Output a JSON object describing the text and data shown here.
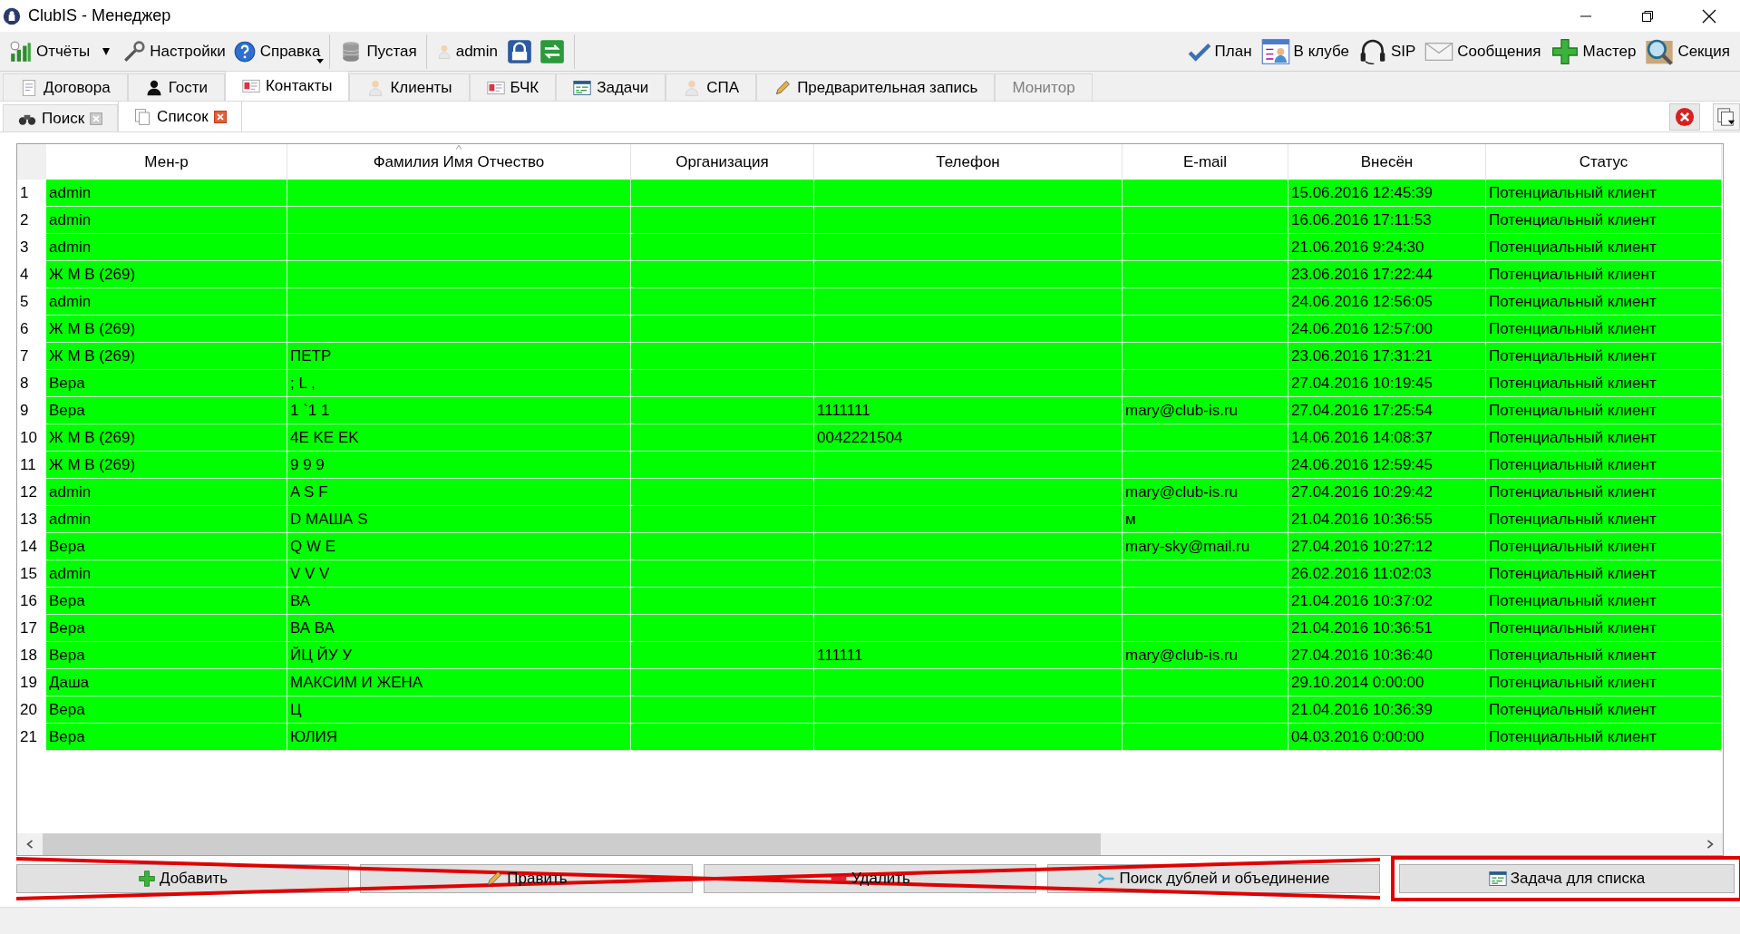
{
  "window": {
    "title": "ClubIS - Менеджер"
  },
  "toolbar": {
    "left": [
      {
        "label": "Отчёты",
        "dropdown": true
      },
      {
        "label": "Настройки",
        "dropdown": false
      },
      {
        "label": "Справка",
        "dropdown": true
      },
      {
        "label": "Пустая",
        "dropdown": false
      },
      {
        "label": "admin",
        "dropdown": false
      }
    ],
    "right": [
      {
        "label": "План"
      },
      {
        "label": "В клубе"
      },
      {
        "label": "SIP"
      },
      {
        "label": "Сообщения"
      },
      {
        "label": "Мастер"
      },
      {
        "label": "Секция"
      }
    ]
  },
  "tabs": [
    {
      "label": "Договора",
      "selected": false,
      "disabled": false
    },
    {
      "label": "Гости",
      "selected": false,
      "disabled": false
    },
    {
      "label": "Контакты",
      "selected": true,
      "disabled": false
    },
    {
      "label": "Клиенты",
      "selected": false,
      "disabled": false
    },
    {
      "label": "БЧК",
      "selected": false,
      "disabled": false
    },
    {
      "label": "Задачи",
      "selected": false,
      "disabled": false
    },
    {
      "label": "СПА",
      "selected": false,
      "disabled": false
    },
    {
      "label": "Предварительная запись",
      "selected": false,
      "disabled": false
    },
    {
      "label": "Монитор",
      "selected": false,
      "disabled": true
    }
  ],
  "subtabs": [
    {
      "label": "Поиск",
      "selected": false
    },
    {
      "label": "Список",
      "selected": true
    }
  ],
  "table": {
    "columns": [
      {
        "label": "Мен-р",
        "sorted": false
      },
      {
        "label": "Фамилия Имя Отчество",
        "sorted": true
      },
      {
        "label": "Организация",
        "sorted": false
      },
      {
        "label": "Телефон",
        "sorted": false
      },
      {
        "label": "E-mail",
        "sorted": false
      },
      {
        "label": "Внесён",
        "sorted": false
      },
      {
        "label": "Статус",
        "sorted": false
      }
    ],
    "rows": [
      {
        "number": "1",
        "cells": [
          "admin",
          "",
          "",
          "",
          "",
          "15.06.2016 12:45:39",
          "Потенциальный клиент"
        ]
      },
      {
        "number": "2",
        "cells": [
          "admin",
          "",
          "",
          "",
          "",
          "16.06.2016 17:11:53",
          "Потенциальный клиент"
        ]
      },
      {
        "number": "3",
        "cells": [
          "admin",
          "",
          "",
          "",
          "",
          "21.06.2016 9:24:30",
          "Потенциальный клиент"
        ]
      },
      {
        "number": "4",
        "cells": [
          "Ж М В (269)",
          "",
          "",
          "",
          "",
          "23.06.2016 17:22:44",
          "Потенциальный клиент"
        ]
      },
      {
        "number": "5",
        "cells": [
          "admin",
          "",
          "",
          "",
          "",
          "24.06.2016 12:56:05",
          "Потенциальный клиент"
        ]
      },
      {
        "number": "6",
        "cells": [
          "Ж М В (269)",
          "",
          "",
          "",
          "",
          "24.06.2016 12:57:00",
          "Потенциальный клиент"
        ]
      },
      {
        "number": "7",
        "cells": [
          "Ж М В (269)",
          "ПЕТР",
          "",
          "",
          "",
          "23.06.2016 17:31:21",
          "Потенциальный клиент"
        ]
      },
      {
        "number": "8",
        "cells": [
          "Вера",
          "; L ,",
          "",
          "",
          "",
          "27.04.2016 10:19:45",
          "Потенциальный клиент"
        ]
      },
      {
        "number": "9",
        "cells": [
          "Вера",
          "1 `1 1",
          "",
          "1111111",
          "mary@club-is.ru",
          "27.04.2016 17:25:54",
          "Потенциальный клиент"
        ]
      },
      {
        "number": "10",
        "cells": [
          "Ж М В (269)",
          "4E KE EK",
          "",
          "0042221504",
          "",
          "14.06.2016 14:08:37",
          "Потенциальный клиент"
        ]
      },
      {
        "number": "11",
        "cells": [
          "Ж М В (269)",
          "9 9 9",
          "",
          "",
          "",
          "24.06.2016 12:59:45",
          "Потенциальный клиент"
        ]
      },
      {
        "number": "12",
        "cells": [
          "admin",
          "A S F",
          "",
          "",
          "mary@club-is.ru",
          "27.04.2016 10:29:42",
          "Потенциальный клиент"
        ]
      },
      {
        "number": "13",
        "cells": [
          "admin",
          "D МАША S",
          "",
          "",
          "м",
          "21.04.2016 10:36:55",
          "Потенциальный клиент"
        ]
      },
      {
        "number": "14",
        "cells": [
          "Вера",
          "Q W E",
          "",
          "",
          "mary-sky@mail.ru",
          "27.04.2016 10:27:12",
          "Потенциальный клиент"
        ]
      },
      {
        "number": "15",
        "cells": [
          "admin",
          "V V V",
          "",
          "",
          "",
          "26.02.2016 11:02:03",
          "Потенциальный клиент"
        ]
      },
      {
        "number": "16",
        "cells": [
          "Вера",
          "ВА",
          "",
          "",
          "",
          "21.04.2016 10:37:02",
          "Потенциальный клиент"
        ]
      },
      {
        "number": "17",
        "cells": [
          "Вера",
          "ВА ВА",
          "",
          "",
          "",
          "21.04.2016 10:36:51",
          "Потенциальный клиент"
        ]
      },
      {
        "number": "18",
        "cells": [
          "Вера",
          "ЙЦ ЙУ У",
          "",
          "111111",
          "mary@club-is.ru",
          "27.04.2016 10:36:40",
          "Потенциальный клиент"
        ]
      },
      {
        "number": "19",
        "cells": [
          "Даша",
          "МАКСИМ И ЖЕНА",
          "",
          "",
          "",
          "29.10.2014 0:00:00",
          "Потенциальный клиент"
        ]
      },
      {
        "number": "20",
        "cells": [
          "Вера",
          "Ц",
          "",
          "",
          "",
          "21.04.2016 10:36:39",
          "Потенциальный клиент"
        ]
      },
      {
        "number": "21",
        "cells": [
          "Вера",
          "ЮЛИЯ",
          "",
          "",
          "",
          "04.03.2016 0:00:00",
          "Потенциальный клиент"
        ]
      }
    ]
  },
  "buttons": [
    {
      "label": "Добавить",
      "crossed_out": true,
      "framed": false
    },
    {
      "label": "Править",
      "crossed_out": true,
      "framed": false
    },
    {
      "label": "Удалить",
      "crossed_out": true,
      "framed": false
    },
    {
      "label": "Поиск дублей и объединение",
      "crossed_out": true,
      "framed": false
    },
    {
      "label": "Задача для списка",
      "crossed_out": false,
      "framed": true
    }
  ]
}
